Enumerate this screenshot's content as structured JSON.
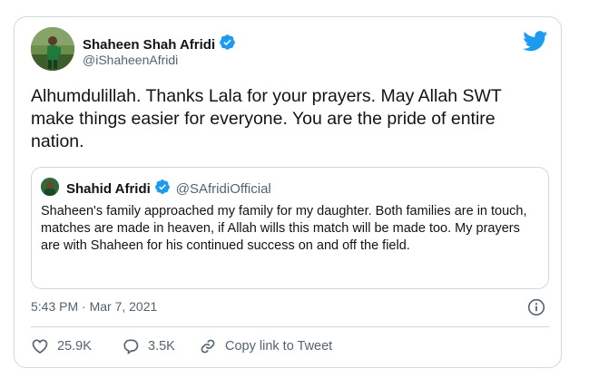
{
  "author": {
    "name": "Shaheen Shah Afridi",
    "handle": "@iShaheenAfridi",
    "avatar_icon": "avatar-photo",
    "verified": true
  },
  "tweet": {
    "text": "Alhumdulillah. Thanks Lala for your prayers. May Allah SWT make things easier for everyone. You are the pride of entire nation."
  },
  "quote": {
    "name": "Shahid Afridi",
    "handle": "@SAfridiOfficial",
    "verified": true,
    "text": "Shaheen's family approached my family for my daughter. Both families are in touch, matches are made in heaven, if Allah wills this match will be made too. My prayers are with Shaheen for his continued success on and off the field."
  },
  "meta": {
    "timestamp": "5:43 PM · Mar 7, 2021"
  },
  "actions": {
    "likes": "25.9K",
    "replies": "3.5K",
    "copy_link": "Copy link to Tweet"
  },
  "colors": {
    "twitter_blue": "#1d9bf0",
    "text_primary": "#0f1419",
    "text_secondary": "#536471",
    "border": "#cfd9de"
  }
}
